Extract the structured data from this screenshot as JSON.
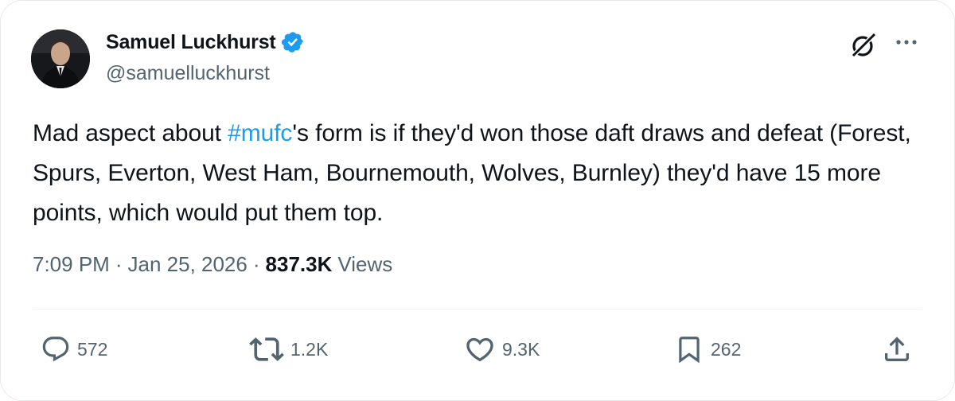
{
  "tweet": {
    "author": {
      "display_name": "Samuel Luckhurst",
      "handle": "@samuelluckhurst",
      "verified": true
    },
    "text_segments": [
      {
        "text": "Mad aspect about "
      },
      {
        "text": "#mufc",
        "hashtag": true
      },
      {
        "text": "'s form is if they'd won those daft draws and defeat (Forest, Spurs, Everton, West Ham, Bournemouth, Wolves, Burnley) they'd have 15 more points, which would put them top."
      }
    ],
    "time": "7:09 PM",
    "separator": "·",
    "date": "Jan 25, 2026",
    "views_count": "837.3K",
    "views_label": "Views"
  },
  "actions": {
    "replies": {
      "icon": "reply-icon",
      "count": "572"
    },
    "reposts": {
      "icon": "repost-icon",
      "count": "1.2K"
    },
    "likes": {
      "icon": "heart-icon",
      "count": "9.3K"
    },
    "bookmarks": {
      "icon": "bookmark-icon",
      "count": "262"
    },
    "share": {
      "icon": "share-icon"
    }
  },
  "header_icons": {
    "grok": "grok-icon",
    "more": "more-icon"
  },
  "colors": {
    "text": "#0f1419",
    "secondary": "#536471",
    "accent": "#1d9bf0"
  }
}
